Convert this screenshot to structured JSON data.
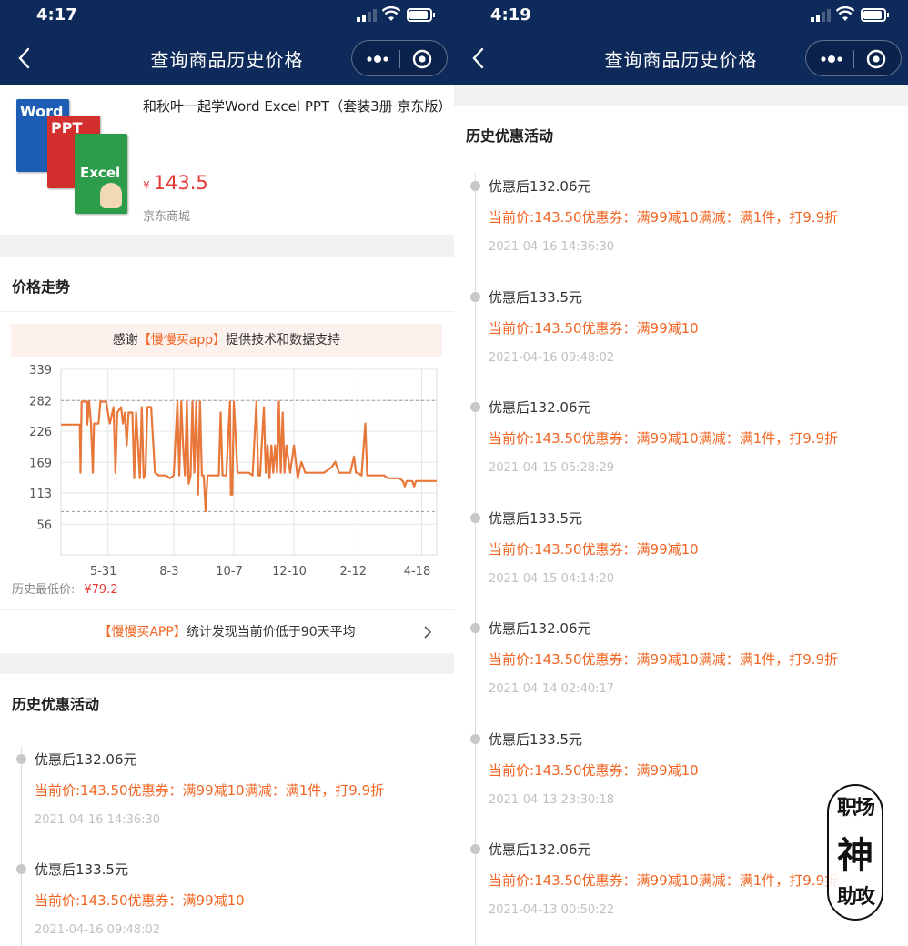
{
  "left": {
    "status": {
      "time": "4:17"
    },
    "nav": {
      "title": "查询商品历史价格"
    },
    "product": {
      "name": "和秋叶一起学Word Excel PPT（套装3册 京东版）",
      "currency": "¥",
      "price": "143.5",
      "store": "京东商城",
      "books": [
        "Word",
        "PPT",
        "Excel"
      ]
    },
    "trend": {
      "title": "价格走势",
      "banner_pre": "感谢",
      "banner_hl": "【慢慢买app】",
      "banner_post": "提供技术和数据支持",
      "lowest_label": "历史最低价:",
      "lowest_value": "¥79.2",
      "stat_hl": "【慢慢买APP】",
      "stat_text": "统计发现当前价低于90天平均"
    },
    "history": {
      "title": "历史优惠活动",
      "entries": [
        {
          "title": "优惠后132.06元",
          "detail": "当前价:143.50优惠券：满99减10满减：满1件，打9.9折",
          "time": "2021-04-16 14:36:30"
        },
        {
          "title": "优惠后133.5元",
          "detail": "当前价:143.50优惠券：满99减10",
          "time": "2021-04-16 09:48:02"
        }
      ]
    }
  },
  "right": {
    "status": {
      "time": "4:19"
    },
    "nav": {
      "title": "查询商品历史价格"
    },
    "history": {
      "title": "历史优惠活动",
      "entries": [
        {
          "title": "优惠后132.06元",
          "detail": "当前价:143.50优惠券：满99减10满减：满1件，打9.9折",
          "time": "2021-04-16 14:36:30"
        },
        {
          "title": "优惠后133.5元",
          "detail": "当前价:143.50优惠券：满99减10",
          "time": "2021-04-16 09:48:02"
        },
        {
          "title": "优惠后132.06元",
          "detail": "当前价:143.50优惠券：满99减10满减：满1件，打9.9折",
          "time": "2021-04-15 05:28:29"
        },
        {
          "title": "优惠后133.5元",
          "detail": "当前价:143.50优惠券：满99减10",
          "time": "2021-04-15 04:14:20"
        },
        {
          "title": "优惠后132.06元",
          "detail": "当前价:143.50优惠券：满99减10满减：满1件，打9.9折",
          "time": "2021-04-14 02:40:17"
        },
        {
          "title": "优惠后133.5元",
          "detail": "当前价:143.50优惠券：满99减10",
          "time": "2021-04-13 23:30:18"
        },
        {
          "title": "优惠后132.06元",
          "detail": "当前价:143.50优惠券：满99减10满减：满1件，打9.9折",
          "time": "2021-04-13 00:50:22"
        }
      ]
    },
    "watermark": {
      "line1": "职场",
      "line2": "神",
      "line3": "助攻"
    }
  },
  "colors": {
    "nav_bg": "#0e2a5a",
    "accent": "#f26522",
    "price_red": "#e53935",
    "line": "#e8773a"
  },
  "chart_data": {
    "type": "line",
    "yticks": [
      339,
      282,
      226,
      169,
      113,
      56
    ],
    "ylim": [
      0,
      339
    ],
    "xticks": [
      "5-31",
      "8-3",
      "10-7",
      "12-10",
      "2-12",
      "4-18"
    ],
    "xtick_positions": [
      0.125,
      0.3,
      0.46,
      0.62,
      0.79,
      0.96
    ],
    "reference_lines": [
      282,
      79.2
    ],
    "grid": true,
    "series": [
      {
        "values": [
          [
            0.0,
            238
          ],
          [
            0.04,
            238
          ],
          [
            0.05,
            238
          ],
          [
            0.052,
            150
          ],
          [
            0.055,
            280
          ],
          [
            0.07,
            280
          ],
          [
            0.07,
            238
          ],
          [
            0.075,
            280
          ],
          [
            0.08,
            240
          ],
          [
            0.085,
            150
          ],
          [
            0.088,
            240
          ],
          [
            0.1,
            240
          ],
          [
            0.105,
            280
          ],
          [
            0.12,
            280
          ],
          [
            0.13,
            240
          ],
          [
            0.14,
            270
          ],
          [
            0.145,
            150
          ],
          [
            0.15,
            260
          ],
          [
            0.16,
            270
          ],
          [
            0.165,
            240
          ],
          [
            0.17,
            260
          ],
          [
            0.175,
            200
          ],
          [
            0.18,
            260
          ],
          [
            0.19,
            260
          ],
          [
            0.195,
            140
          ],
          [
            0.2,
            260
          ],
          [
            0.21,
            140
          ],
          [
            0.215,
            270
          ],
          [
            0.22,
            140
          ],
          [
            0.225,
            150
          ],
          [
            0.23,
            270
          ],
          [
            0.24,
            270
          ],
          [
            0.25,
            150
          ],
          [
            0.26,
            145
          ],
          [
            0.28,
            145
          ],
          [
            0.29,
            140
          ],
          [
            0.3,
            145
          ],
          [
            0.31,
            280
          ],
          [
            0.315,
            145
          ],
          [
            0.32,
            280
          ],
          [
            0.325,
            200
          ],
          [
            0.33,
            145
          ],
          [
            0.335,
            280
          ],
          [
            0.34,
            130
          ],
          [
            0.345,
            145
          ],
          [
            0.35,
            280
          ],
          [
            0.355,
            150
          ],
          [
            0.36,
            280
          ],
          [
            0.365,
            110
          ],
          [
            0.37,
            280
          ],
          [
            0.375,
            145
          ],
          [
            0.38,
            145
          ],
          [
            0.385,
            80
          ],
          [
            0.39,
            145
          ],
          [
            0.41,
            145
          ],
          [
            0.42,
            145
          ],
          [
            0.425,
            260
          ],
          [
            0.43,
            145
          ],
          [
            0.44,
            145
          ],
          [
            0.45,
            280
          ],
          [
            0.452,
            110
          ],
          [
            0.456,
            110
          ],
          [
            0.46,
            280
          ],
          [
            0.47,
            150
          ],
          [
            0.5,
            150
          ],
          [
            0.51,
            145
          ],
          [
            0.52,
            280
          ],
          [
            0.525,
            145
          ],
          [
            0.53,
            145
          ],
          [
            0.54,
            270
          ],
          [
            0.545,
            150
          ],
          [
            0.55,
            200
          ],
          [
            0.555,
            140
          ],
          [
            0.56,
            200
          ],
          [
            0.565,
            150
          ],
          [
            0.57,
            200
          ],
          [
            0.575,
            150
          ],
          [
            0.58,
            280
          ],
          [
            0.585,
            150
          ],
          [
            0.59,
            260
          ],
          [
            0.595,
            150
          ],
          [
            0.6,
            200
          ],
          [
            0.61,
            150
          ],
          [
            0.62,
            200
          ],
          [
            0.63,
            140
          ],
          [
            0.64,
            170
          ],
          [
            0.65,
            150
          ],
          [
            0.66,
            150
          ],
          [
            0.68,
            150
          ],
          [
            0.7,
            150
          ],
          [
            0.72,
            160
          ],
          [
            0.73,
            170
          ],
          [
            0.74,
            150
          ],
          [
            0.76,
            150
          ],
          [
            0.77,
            150
          ],
          [
            0.78,
            180
          ],
          [
            0.785,
            150
          ],
          [
            0.79,
            150
          ],
          [
            0.8,
            145
          ],
          [
            0.81,
            240
          ],
          [
            0.815,
            145
          ],
          [
            0.83,
            145
          ],
          [
            0.86,
            145
          ],
          [
            0.87,
            140
          ],
          [
            0.9,
            140
          ],
          [
            0.91,
            135
          ],
          [
            0.915,
            125
          ],
          [
            0.92,
            135
          ],
          [
            0.935,
            135
          ],
          [
            0.94,
            125
          ],
          [
            0.945,
            135
          ],
          [
            1.0,
            135
          ]
        ]
      }
    ]
  }
}
